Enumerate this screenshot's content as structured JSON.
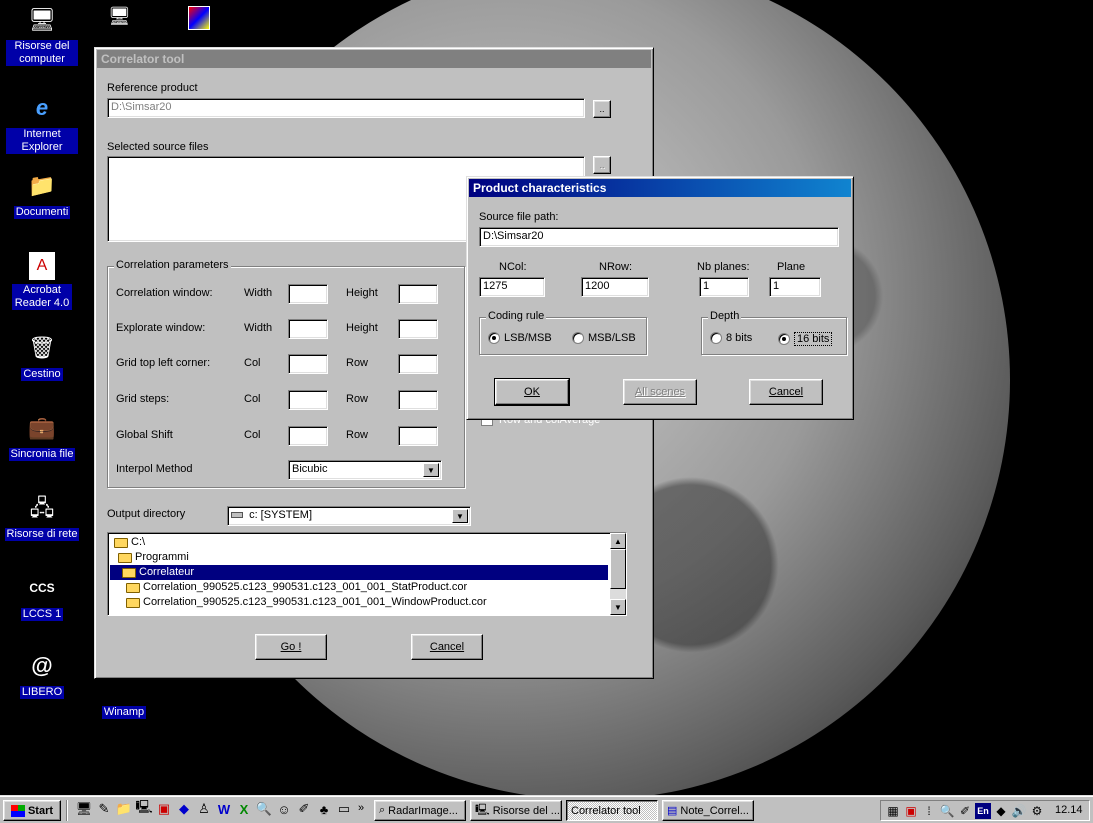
{
  "desktop": {
    "icons": [
      {
        "label": "Risorse del computer",
        "icon": "computer-icon"
      },
      {
        "label": "Internet Explorer",
        "icon": "ie-icon"
      },
      {
        "label": "Documenti",
        "icon": "folder-icon"
      },
      {
        "label": "Acrobat Reader 4.0",
        "icon": "acrobat-icon"
      },
      {
        "label": "Cestino",
        "icon": "recycle-bin-icon"
      },
      {
        "label": "Sincronia file",
        "icon": "briefcase-icon"
      },
      {
        "label": "Risorse di rete",
        "icon": "network-icon"
      },
      {
        "label": "LCCS 1",
        "icon": "lccs-icon"
      },
      {
        "label": "LIBERO",
        "icon": "libero-icon"
      },
      {
        "label": "Winamp",
        "icon": "winamp-icon"
      }
    ]
  },
  "correlator": {
    "title": "Correlator tool",
    "reference_label": "Reference product",
    "reference_value": "D:\\Simsar20",
    "browse_label": "..",
    "sources_label": "Selected source files",
    "params_group": "Correlation parameters",
    "rows": [
      {
        "label": "Correlation window:",
        "a": "Width",
        "b": "Height"
      },
      {
        "label": "Explorate window:",
        "a": "Width",
        "b": "Height"
      },
      {
        "label": "Grid top left corner:",
        "a": "Col",
        "b": "Row"
      },
      {
        "label": "Grid steps:",
        "a": "Col",
        "b": "Row"
      },
      {
        "label": "Global Shift",
        "a": "Col",
        "b": "Row"
      }
    ],
    "interpol_label": "Interpol Method",
    "interpol_value": "Bicubic",
    "hidden_check_label": "Row and colAverage",
    "output_label": "Output directory",
    "drive_value": "c: [SYSTEM]",
    "tree": [
      {
        "text": "C:\\",
        "indent": 0,
        "selected": false
      },
      {
        "text": "Programmi",
        "indent": 1,
        "selected": false
      },
      {
        "text": "Correlateur",
        "indent": 2,
        "selected": true
      },
      {
        "text": "Correlation_990525.c123_990531.c123_001_001_StatProduct.cor",
        "indent": 3,
        "selected": false
      },
      {
        "text": "Correlation_990525.c123_990531.c123_001_001_WindowProduct.cor",
        "indent": 3,
        "selected": false
      }
    ],
    "go_label": "Go !",
    "cancel_label": "Cancel"
  },
  "product": {
    "title": "Product characteristics",
    "path_label": "Source file path:",
    "path_value": "D:\\Simsar20",
    "ncol_label": "NCol:",
    "ncol_value": "1275",
    "nrow_label": "NRow:",
    "nrow_value": "1200",
    "nbplanes_label": "Nb planes:",
    "nbplanes_value": "1",
    "plane_label": "Plane",
    "plane_value": "1",
    "coding_group": "Coding rule",
    "coding_options": [
      "LSB/MSB",
      "MSB/LSB"
    ],
    "coding_selected": "LSB/MSB",
    "depth_group": "Depth",
    "depth_options": [
      "8 bits",
      "16 bits"
    ],
    "depth_selected": "16 bits",
    "ok_label": "OK",
    "allscenes_label": "All scenes",
    "cancel_label": "Cancel"
  },
  "taskbar": {
    "start_label": "Start",
    "tasks": [
      "RadarImage...",
      "Risorse del ...",
      "Correlator tool",
      "Note_Correl..."
    ],
    "active_task": "Correlator tool",
    "clock": "12.14",
    "chevron": "»"
  }
}
